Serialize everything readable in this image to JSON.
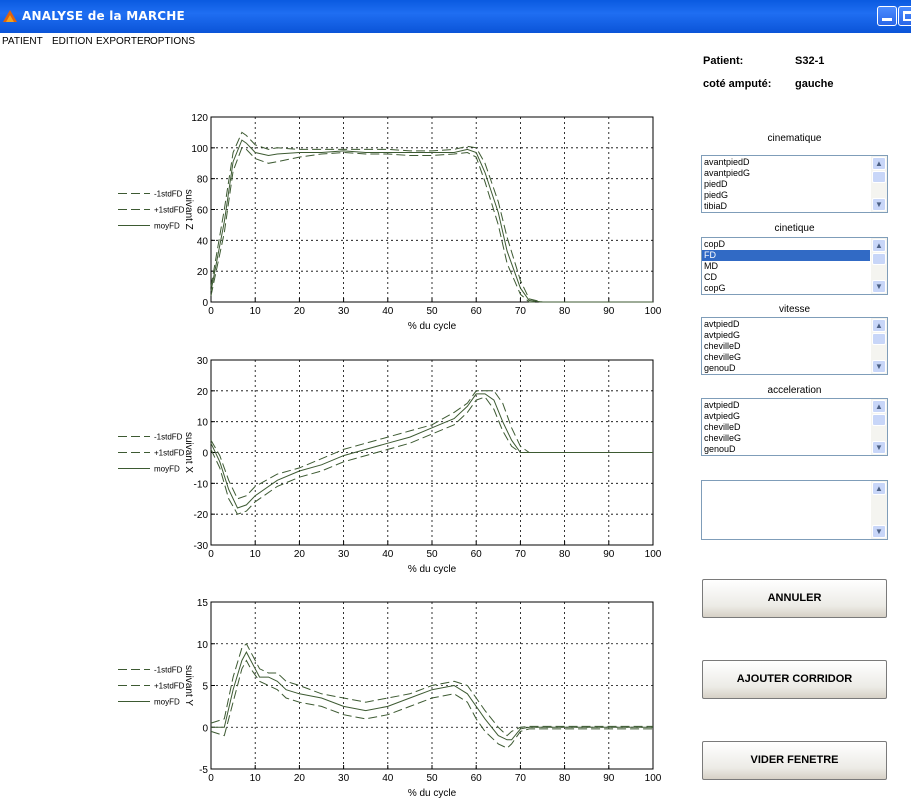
{
  "window": {
    "title": "ANALYSE de la MARCHE"
  },
  "menu": [
    "PATIENT",
    "EDITION",
    "EXPORTER",
    "OPTIONS"
  ],
  "info": {
    "patient_label": "Patient:",
    "patient_value": "S32-1",
    "side_label": "coté amputé:",
    "side_value": "gauche"
  },
  "lists": [
    {
      "title": "cinematique",
      "items": [
        "avantpiedD",
        "avantpiedG",
        "piedD",
        "piedG",
        "tibiaD"
      ],
      "selected": -1
    },
    {
      "title": "cinetique",
      "items": [
        "copD",
        "FD",
        "MD",
        "CD",
        "copG"
      ],
      "selected": 1
    },
    {
      "title": "vitesse",
      "items": [
        "avtpiedD",
        "avtpiedG",
        "chevilleD",
        "chevilleG",
        "genouD"
      ],
      "selected": -1
    },
    {
      "title": "acceleration",
      "items": [
        "avtpiedD",
        "avtpiedG",
        "chevilleD",
        "chevilleG",
        "genouD"
      ],
      "selected": -1
    },
    {
      "title": "",
      "items": [],
      "selected": -1
    }
  ],
  "buttons": {
    "cancel": "ANNULER",
    "add_corridor": "AJOUTER CORRIDOR",
    "clear_window": "VIDER FENETRE"
  },
  "colors": {
    "curve": "#3d5a32",
    "titlebar": "#0a5ae0",
    "selection": "#316ac5"
  },
  "chart_data": [
    {
      "type": "line",
      "xlabel": "% du cycle",
      "ylabel": "suivant Z",
      "xlim": [
        0,
        100
      ],
      "ylim": [
        0,
        120
      ],
      "xticks": [
        0,
        10,
        20,
        30,
        40,
        50,
        60,
        70,
        80,
        90,
        100
      ],
      "yticks": [
        0,
        20,
        40,
        60,
        80,
        100,
        120
      ],
      "grid": true,
      "legend_position": "left",
      "x": [
        0,
        3,
        5,
        7,
        8,
        10,
        13,
        15,
        20,
        25,
        30,
        35,
        40,
        45,
        50,
        55,
        58,
        60,
        62,
        65,
        67,
        70,
        72,
        75,
        80,
        90,
        100
      ],
      "series": [
        {
          "name": "-1stdFD",
          "values": [
            4,
            45,
            85,
            100,
            99,
            93,
            90,
            91,
            94,
            96,
            97,
            96,
            96,
            95,
            95,
            96,
            97,
            94,
            78,
            50,
            25,
            5,
            0,
            0,
            0,
            0,
            0
          ]
        },
        {
          "name": "+1stdFD",
          "values": [
            10,
            60,
            97,
            110,
            108,
            102,
            99,
            100,
            99,
            99,
            99,
            99,
            99,
            98,
            98,
            99,
            101,
            100,
            90,
            65,
            42,
            14,
            2,
            0,
            0,
            0,
            0
          ]
        },
        {
          "name": "moyFD",
          "values": [
            7,
            52,
            91,
            105,
            103,
            97,
            95,
            96,
            97,
            97,
            98,
            97,
            97,
            97,
            97,
            97,
            99,
            97,
            84,
            58,
            33,
            9,
            1,
            0,
            0,
            0,
            0
          ]
        }
      ]
    },
    {
      "type": "line",
      "xlabel": "% du cycle",
      "ylabel": "suivant X",
      "xlim": [
        0,
        100
      ],
      "ylim": [
        -30,
        30
      ],
      "xticks": [
        0,
        10,
        20,
        30,
        40,
        50,
        60,
        70,
        80,
        90,
        100
      ],
      "yticks": [
        -30,
        -20,
        -10,
        0,
        10,
        20,
        30
      ],
      "grid": true,
      "legend_position": "left",
      "x": [
        0,
        2,
        4,
        6,
        8,
        10,
        15,
        20,
        25,
        30,
        35,
        40,
        45,
        50,
        55,
        58,
        60,
        62,
        64,
        66,
        68,
        70,
        72,
        75,
        80,
        90,
        100
      ],
      "series": [
        {
          "name": "-1stdFD",
          "values": [
            1,
            -5,
            -15,
            -20,
            -19,
            -16,
            -11,
            -8,
            -6,
            -3,
            -1,
            1,
            3,
            6,
            9,
            13,
            17,
            18,
            14,
            7,
            2,
            0,
            0,
            0,
            0,
            0,
            0
          ]
        },
        {
          "name": "+1stdFD",
          "values": [
            4,
            -1,
            -9,
            -15,
            -14,
            -11,
            -7,
            -5,
            -2,
            1,
            3,
            5,
            7,
            9,
            13,
            16,
            20,
            20,
            20,
            16,
            8,
            2,
            0,
            0,
            0,
            0,
            0
          ]
        },
        {
          "name": "moyFD",
          "values": [
            3,
            -3,
            -12,
            -18,
            -17,
            -14,
            -9,
            -6,
            -4,
            -1,
            1,
            3,
            5,
            8,
            11,
            15,
            19,
            19,
            17,
            10,
            4,
            0,
            0,
            0,
            0,
            0,
            0
          ]
        }
      ]
    },
    {
      "type": "line",
      "xlabel": "% du cycle",
      "ylabel": "suivant Y",
      "xlim": [
        0,
        100
      ],
      "ylim": [
        -5,
        15
      ],
      "xticks": [
        0,
        10,
        20,
        30,
        40,
        50,
        60,
        70,
        80,
        90,
        100
      ],
      "yticks": [
        -5,
        0,
        5,
        10,
        15
      ],
      "grid": true,
      "legend_position": "left",
      "x": [
        0,
        3,
        5,
        7,
        8,
        9,
        11,
        13,
        15,
        17,
        20,
        25,
        30,
        35,
        40,
        45,
        50,
        55,
        58,
        60,
        62,
        65,
        67,
        68,
        70,
        72,
        75,
        80,
        90,
        100
      ],
      "series": [
        {
          "name": "-1stdFD",
          "values": [
            -0.5,
            -1,
            3,
            7,
            8,
            7,
            5.5,
            5,
            4.5,
            3.5,
            3,
            2.5,
            1.5,
            1,
            1.5,
            2.5,
            3.5,
            4,
            3,
            1,
            -0.5,
            -2,
            -2.5,
            -2,
            -0.5,
            -0.2,
            -0.2,
            -0.2,
            -0.2,
            -0.2
          ]
        },
        {
          "name": "+1stdFD",
          "values": [
            0.5,
            1,
            6,
            9.5,
            10,
            9,
            7,
            6.5,
            6.5,
            5.5,
            5,
            4,
            3.5,
            3,
            3.5,
            4,
            5,
            5.5,
            5,
            3.5,
            2,
            0,
            -1,
            -0.5,
            0,
            0.1,
            0.1,
            0.1,
            0.1,
            0.1
          ]
        },
        {
          "name": "moyFD",
          "values": [
            0,
            0,
            4.5,
            8,
            9,
            8,
            6,
            6,
            5.5,
            4.5,
            4,
            3.5,
            2.5,
            2,
            2.5,
            3.5,
            4.5,
            5,
            4,
            2.5,
            1,
            -1,
            -1.5,
            -1.5,
            -0.2,
            0,
            0,
            0,
            0,
            0
          ]
        }
      ]
    }
  ]
}
